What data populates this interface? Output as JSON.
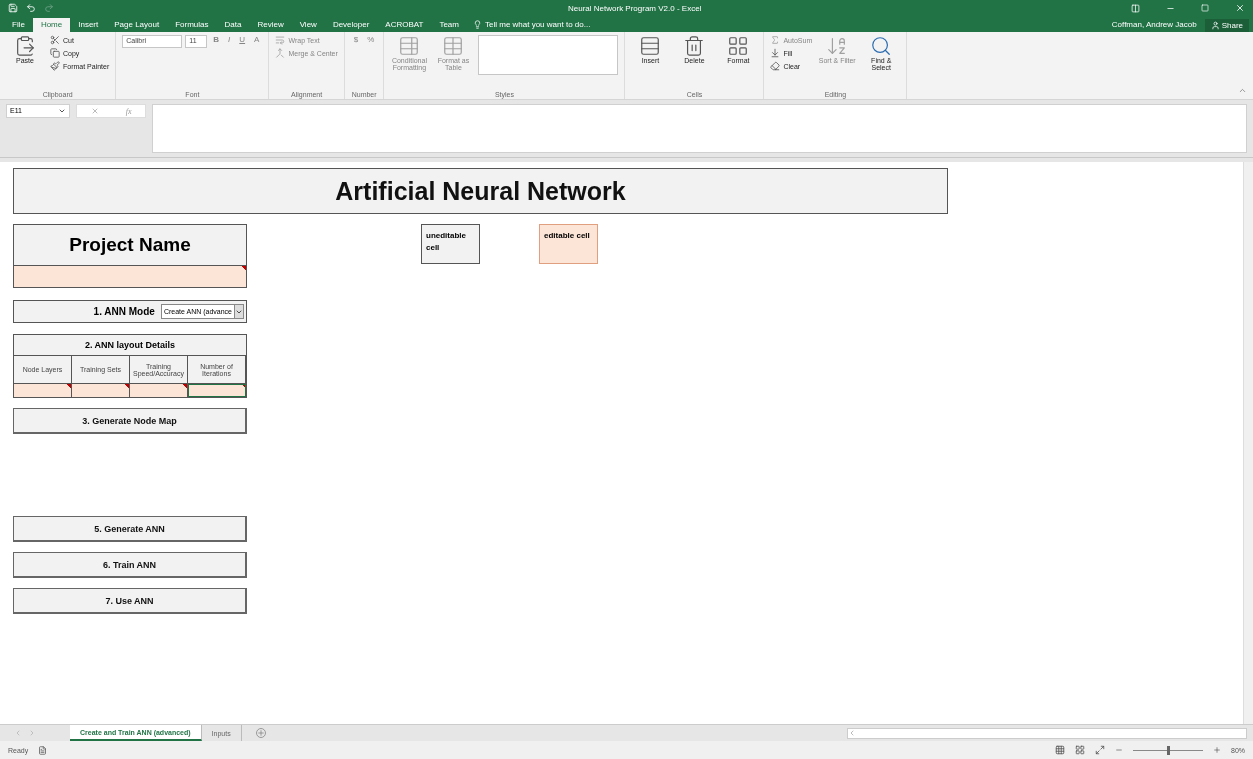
{
  "window": {
    "title": "Neural Network Program V2.0 - Excel"
  },
  "ribbon_tabs": [
    {
      "label": "File",
      "selected": false
    },
    {
      "label": "Home",
      "selected": true
    },
    {
      "label": "Insert",
      "selected": false
    },
    {
      "label": "Page Layout",
      "selected": false
    },
    {
      "label": "Formulas",
      "selected": false
    },
    {
      "label": "Data",
      "selected": false
    },
    {
      "label": "Review",
      "selected": false
    },
    {
      "label": "View",
      "selected": false
    },
    {
      "label": "Developer",
      "selected": false
    },
    {
      "label": "ACROBAT",
      "selected": false
    },
    {
      "label": "Team",
      "selected": false
    }
  ],
  "tell_me": "Tell me what you want to do...",
  "user": "Coffman, Andrew Jacob",
  "share": "Share",
  "ribbon_groups": [
    {
      "label": "Clipboard",
      "commands": [
        {
          "label": "Paste",
          "kind": "large",
          "disabled": false
        },
        {
          "label": "Cut",
          "kind": "small",
          "disabled": false
        },
        {
          "label": "Copy",
          "kind": "small",
          "disabled": false
        },
        {
          "label": "Format Painter",
          "kind": "small",
          "disabled": false
        }
      ]
    },
    {
      "label": "Font",
      "commands": [
        {
          "label": "Calibri",
          "kind": "field"
        },
        {
          "label": "11",
          "kind": "field"
        },
        {
          "label": "B",
          "kind": "glyph",
          "disabled": true
        },
        {
          "label": "I",
          "kind": "glyph",
          "disabled": true
        },
        {
          "label": "U",
          "kind": "glyph",
          "disabled": true
        },
        {
          "label": "A",
          "kind": "glyph",
          "disabled": true
        }
      ]
    },
    {
      "label": "Alignment",
      "commands": [
        {
          "label": "Wrap Text",
          "kind": "small",
          "disabled": true
        },
        {
          "label": "Merge & Center",
          "kind": "small",
          "disabled": true
        }
      ]
    },
    {
      "label": "Number",
      "commands": [
        {
          "label": "$",
          "kind": "glyph",
          "disabled": true
        },
        {
          "label": "%",
          "kind": "glyph",
          "disabled": true
        }
      ]
    },
    {
      "label": "Styles",
      "commands": [
        {
          "label": "Conditional Formatting",
          "kind": "large",
          "disabled": true
        },
        {
          "label": "Format as Table",
          "kind": "large",
          "disabled": true
        }
      ]
    },
    {
      "label": "Cells",
      "commands": [
        {
          "label": "Insert",
          "kind": "large",
          "disabled": false
        },
        {
          "label": "Delete",
          "kind": "large",
          "disabled": false
        },
        {
          "label": "Format",
          "kind": "large",
          "disabled": false
        }
      ]
    },
    {
      "label": "Editing",
      "commands": [
        {
          "label": "AutoSum",
          "kind": "small",
          "disabled": true
        },
        {
          "label": "Fill",
          "kind": "small",
          "disabled": false
        },
        {
          "label": "Clear",
          "kind": "small",
          "disabled": false
        },
        {
          "label": "Sort & Filter",
          "kind": "large",
          "disabled": true
        },
        {
          "label": "Find & Select",
          "kind": "large",
          "disabled": false
        }
      ]
    }
  ],
  "name_box": "E11",
  "formula_fx": "fx",
  "sheet": {
    "title": "Artificial Neural Network",
    "project": {
      "label": "Project Name"
    },
    "mode": {
      "label": "1. ANN Mode",
      "value": "Create ANN (advance"
    },
    "layout": {
      "label": "2. ANN layout Details",
      "columns": [
        "Node Layers",
        "Training Sets",
        "Training Speed/Accuracy",
        "Number of Iterations"
      ]
    },
    "steps_top": [
      "3. Generate Node Map"
    ],
    "steps_bottom": [
      "5. Generate ANN",
      "6. Train ANN",
      "7. Use ANN"
    ],
    "legend": [
      {
        "label": "uneditable cell",
        "kind": "uneditable"
      },
      {
        "label": "editable cell",
        "kind": "editable"
      }
    ]
  },
  "sheet_tabs": [
    {
      "label": "Create and Train ANN (advanced)",
      "selected": true
    },
    {
      "label": "Inputs",
      "selected": false
    }
  ],
  "status": "Ready",
  "zoom": "80%",
  "zoom_slider": {
    "level": 0.5
  }
}
